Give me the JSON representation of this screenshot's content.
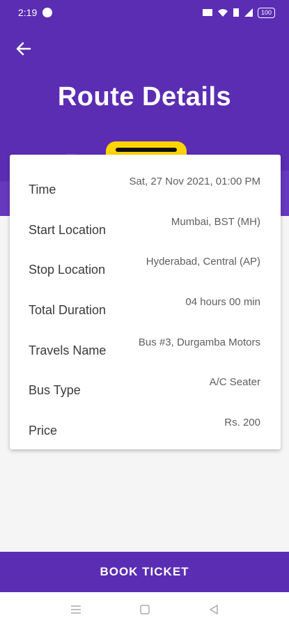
{
  "status_bar": {
    "time": "2:19",
    "battery": "100"
  },
  "header": {
    "title": "Route Details"
  },
  "details": [
    {
      "label": "Time",
      "value": "Sat, 27 Nov 2021, 01:00 PM"
    },
    {
      "label": "Start Location",
      "value": "Mumbai, BST (MH)"
    },
    {
      "label": "Stop Location",
      "value": "Hyderabad, Central (AP)"
    },
    {
      "label": "Total Duration",
      "value": "04 hours 00 min"
    },
    {
      "label": "Travels Name",
      "value": "Bus #3, Durgamba Motors"
    },
    {
      "label": "Bus Type",
      "value": "A/C Seater"
    },
    {
      "label": "Price",
      "value": "Rs. 200"
    }
  ],
  "footer": {
    "book_label": "BOOK TICKET"
  },
  "colors": {
    "primary": "#5b2db3",
    "accent": "#ffd400"
  },
  "icons": {
    "back": "arrow-left-icon",
    "nav_menu": "menu-icon",
    "nav_home": "square-icon",
    "nav_back": "triangle-back-icon"
  }
}
